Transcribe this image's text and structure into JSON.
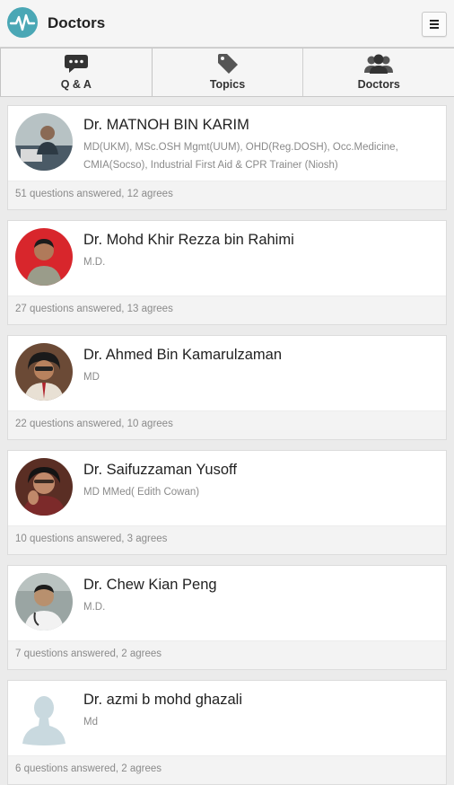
{
  "header": {
    "title": "Doctors",
    "logo_icon": "pulse-logo-icon",
    "menu_icon": "hamburger-menu-icon"
  },
  "tabs": [
    {
      "label": "Q & A",
      "icon": "speech-bubble-icon",
      "active": false
    },
    {
      "label": "Topics",
      "icon": "tag-icon",
      "active": false
    },
    {
      "label": "Doctors",
      "icon": "people-icon",
      "active": true
    }
  ],
  "doctors": [
    {
      "name": "Dr. MATNOH BIN KARIM",
      "credentials": "MD(UKM), MSc.OSH Mgmt(UUM), OHD(Reg.DOSH), Occ.Medicine, CMIA(Socso), Industrial First Aid & CPR Trainer (Niosh)",
      "stats": "51 questions answered, 12 agrees",
      "avatar_color": "#7b8a8f"
    },
    {
      "name": "Dr. Mohd Khir Rezza bin Rahimi",
      "credentials": "M.D.",
      "stats": "27 questions answered, 13 agrees",
      "avatar_color": "#d8262c"
    },
    {
      "name": "Dr. Ahmed Bin Kamarulzaman",
      "credentials": "MD",
      "stats": "22 questions answered, 10 agrees",
      "avatar_color": "#5a3a2a"
    },
    {
      "name": "Dr. Saifuzzaman Yusoff",
      "credentials": "MD MMed( Edith Cowan)",
      "stats": "10 questions answered, 3 agrees",
      "avatar_color": "#6b3a2e"
    },
    {
      "name": "Dr. Chew Kian Peng",
      "credentials": "M.D.",
      "stats": "7 questions answered, 2 agrees",
      "avatar_color": "#8d9796"
    },
    {
      "name": "Dr. azmi b mohd ghazali",
      "credentials": "Md",
      "stats": "6 questions answered, 2 agrees",
      "avatar_color": "#c5d6dc"
    }
  ]
}
